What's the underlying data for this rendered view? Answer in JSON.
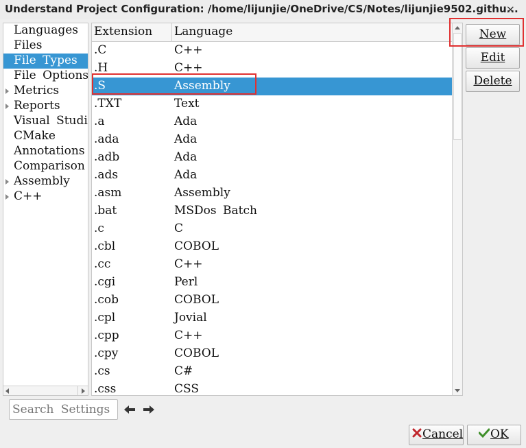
{
  "window": {
    "title": "Understand Project Configuration: /home/lijunjie/OneDrive/CS/Notes/lijunjie9502.githu...",
    "close_glyph": "×"
  },
  "sidebar": {
    "items": [
      {
        "label": "Languages",
        "expandable": false,
        "selected": false
      },
      {
        "label": "Files",
        "expandable": false,
        "selected": false
      },
      {
        "label": "File Types",
        "expandable": false,
        "selected": true
      },
      {
        "label": "File Options",
        "expandable": false,
        "selected": false
      },
      {
        "label": "Metrics",
        "expandable": true,
        "selected": false
      },
      {
        "label": "Reports",
        "expandable": true,
        "selected": false
      },
      {
        "label": "Visual Studio",
        "expandable": false,
        "selected": false
      },
      {
        "label": "CMake",
        "expandable": false,
        "selected": false
      },
      {
        "label": "Annotations",
        "expandable": false,
        "selected": false
      },
      {
        "label": "Comparison",
        "expandable": false,
        "selected": false
      },
      {
        "label": "Assembly",
        "expandable": true,
        "selected": false
      },
      {
        "label": "C++",
        "expandable": true,
        "selected": false
      }
    ]
  },
  "table": {
    "headers": [
      "Extension",
      "Language"
    ],
    "selected_index": 2,
    "rows": [
      [
        ".C",
        "C++"
      ],
      [
        ".H",
        "C++"
      ],
      [
        ".S",
        "Assembly"
      ],
      [
        ".TXT",
        "Text"
      ],
      [
        ".a",
        "Ada"
      ],
      [
        ".ada",
        "Ada"
      ],
      [
        ".adb",
        "Ada"
      ],
      [
        ".ads",
        "Ada"
      ],
      [
        ".asm",
        "Assembly"
      ],
      [
        ".bat",
        "MSDos Batch"
      ],
      [
        ".c",
        "C"
      ],
      [
        ".cbl",
        "COBOL"
      ],
      [
        ".cc",
        "C++"
      ],
      [
        ".cgi",
        "Perl"
      ],
      [
        ".cob",
        "COBOL"
      ],
      [
        ".cpl",
        "Jovial"
      ],
      [
        ".cpp",
        "C++"
      ],
      [
        ".cpy",
        "COBOL"
      ],
      [
        ".cs",
        "C#"
      ],
      [
        ".css",
        "CSS"
      ]
    ]
  },
  "actions": {
    "new_label": "New",
    "edit_label": "Edit",
    "delete_label": "Delete"
  },
  "search": {
    "placeholder": "Search Settings"
  },
  "footer": {
    "cancel_label": "Cancel",
    "ok_label": "OK"
  },
  "colors": {
    "selection": "#3796d3",
    "highlight_box": "#e03030"
  },
  "icons": {
    "back": "arrow-left-icon",
    "forward": "arrow-right-icon",
    "cancel": "red-x-icon",
    "ok": "green-check-icon"
  }
}
